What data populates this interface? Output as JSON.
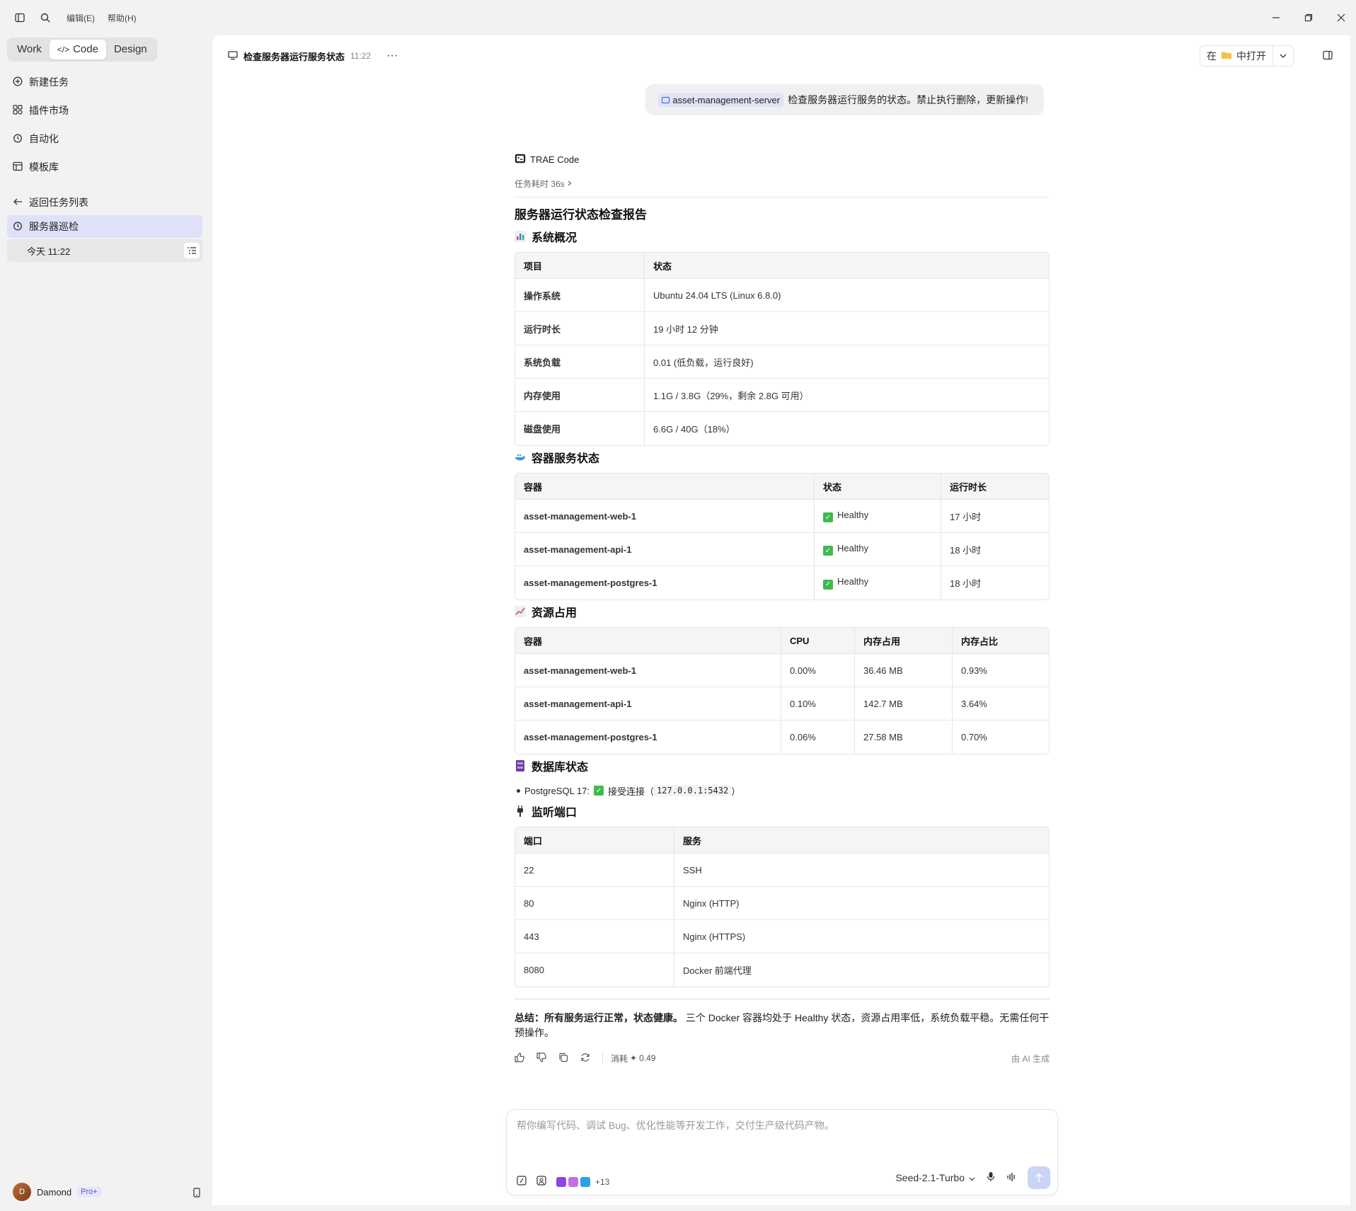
{
  "menu": {
    "edit": "编辑(E)",
    "help": "帮助(H)"
  },
  "modes": [
    "Work",
    "Code",
    "Design"
  ],
  "sidebar": {
    "items": [
      "新建任务",
      "插件市场",
      "自动化",
      "模板库"
    ],
    "back": "返回任务列表",
    "current_task": "服务器巡检",
    "sub_item": "今天 11:22"
  },
  "user": {
    "name": "Damond",
    "badge": "Pro+"
  },
  "header": {
    "title": "检查服务器运行服务状态",
    "time": "11:22",
    "open_prefix": "在",
    "open_suffix": "中打开"
  },
  "user_message": {
    "chip": "asset-management-server",
    "text": "检查服务器运行服务的状态。禁止执行删除，更新操作!"
  },
  "agent": {
    "name": "TRAE Code",
    "duration": "任务耗时 36s"
  },
  "report": {
    "title": "服务器运行状态检查报告",
    "overview": {
      "heading": "系统概况",
      "columns": [
        "项目",
        "状态"
      ],
      "rows": [
        [
          "操作系统",
          "Ubuntu 24.04 LTS (Linux 6.8.0)"
        ],
        [
          "运行时长",
          "19 小时 12 分钟"
        ],
        [
          "系统负载",
          "0.01 (低负载，运行良好)"
        ],
        [
          "内存使用",
          "1.1G / 3.8G（29%，剩余 2.8G 可用）"
        ],
        [
          "磁盘使用",
          "6.6G / 40G（18%）"
        ]
      ]
    },
    "containers": {
      "heading": "容器服务状态",
      "columns": [
        "容器",
        "状态",
        "运行时长"
      ],
      "rows": [
        [
          "asset-management-web-1",
          "Healthy",
          "17 小时"
        ],
        [
          "asset-management-api-1",
          "Healthy",
          "18 小时"
        ],
        [
          "asset-management-postgres-1",
          "Healthy",
          "18 小时"
        ]
      ]
    },
    "resources": {
      "heading": "资源占用",
      "columns": [
        "容器",
        "CPU",
        "内存占用",
        "内存占比"
      ],
      "rows": [
        [
          "asset-management-web-1",
          "0.00%",
          "36.46 MB",
          "0.93%"
        ],
        [
          "asset-management-api-1",
          "0.10%",
          "142.7 MB",
          "3.64%"
        ],
        [
          "asset-management-postgres-1",
          "0.06%",
          "27.58 MB",
          "0.70%"
        ]
      ]
    },
    "database": {
      "heading": "数据库状态",
      "label": "PostgreSQL 17:",
      "status": "接受连接",
      "addr": "127.0.0.1:5432"
    },
    "ports": {
      "heading": "监听端口",
      "columns": [
        "端口",
        "服务"
      ],
      "rows": [
        [
          "22",
          "SSH"
        ],
        [
          "80",
          "Nginx (HTTP)"
        ],
        [
          "443",
          "Nginx (HTTPS)"
        ],
        [
          "8080",
          "Docker 前端代理"
        ]
      ]
    },
    "summary_bold": "总结：所有服务运行正常，状态健康。",
    "summary_text": "三个 Docker 容器均处于 Healthy 状态，资源占用率低，系统负载平稳。无需任何干预操作。"
  },
  "actions": {
    "cost_label": "消耗",
    "cost_value": "0.49",
    "ai_note": "由 AI 生成"
  },
  "composer": {
    "placeholder": "帮你编写代码、调试 Bug、优化性能等开发工作，交付生产级代码产物。",
    "more": "+13",
    "model": "Seed-2.1-Turbo"
  },
  "colors": {
    "accent": "#5b55d6",
    "selected": "#dfe1f8",
    "healthy": "#3fb950"
  }
}
